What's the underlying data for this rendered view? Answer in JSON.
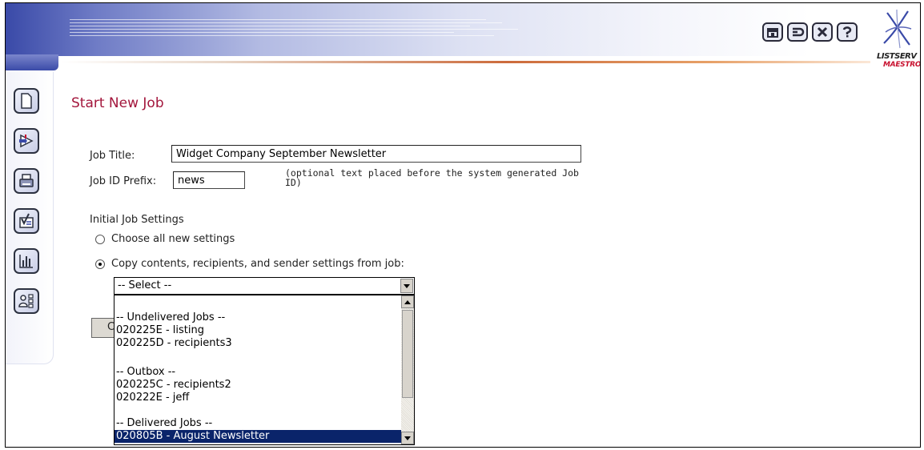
{
  "header": {
    "toolbar_icons": [
      "home-icon",
      "logout-icon",
      "exit-icon",
      "help-icon"
    ],
    "logo_line1": "LISTSERV",
    "logo_line2": "MAESTRO"
  },
  "sidebar": {
    "icons": [
      "new-job-icon",
      "job-edit-icon",
      "print-icon",
      "approve-icon",
      "reports-icon",
      "users-icon"
    ]
  },
  "page": {
    "title": "Start New Job"
  },
  "form": {
    "job_title_label": "Job Title:",
    "job_title_value": "Widget Company September Newsletter",
    "job_id_prefix_label": "Job ID Prefix:",
    "job_id_prefix_value": "news",
    "job_id_prefix_hint": "(optional text placed before the system generated Job ID)",
    "initial_settings_label": "Initial Job Settings",
    "option_new": "Choose all new settings",
    "option_copy": "Copy contents, recipients, and sender settings from job:",
    "selected_option": "copy",
    "select_value": "-- Select --",
    "hidden_button_label": "C"
  },
  "dropdown": {
    "options": [
      "",
      "-- Undelivered Jobs --",
      "020225E - listing",
      "020225D - recipients3",
      "",
      "-- Outbox --",
      "020225C - recipients2",
      "020222E - jeff",
      "",
      "-- Delivered Jobs --",
      "020805B - August Newsletter"
    ],
    "highlighted": "020805B - August Newsletter"
  },
  "colors": {
    "title": "#a3163c",
    "header_blue": "#3a4aa8",
    "accent_orange": "#cc6b3c",
    "selection": "#0a246a",
    "logo_red": "#c8102e"
  }
}
